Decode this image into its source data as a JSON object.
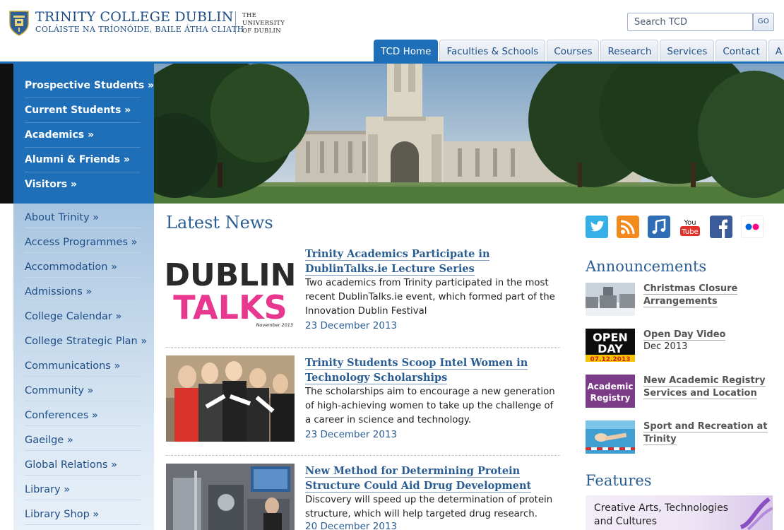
{
  "header": {
    "title": "TRINITY COLLEGE DUBLIN",
    "subtitle": "COLÁISTE NA TRÍONÓIDE, BAILE ÁTHA CLIATH",
    "university": [
      "THE",
      "UNIVERSITY",
      "OF DUBLIN"
    ],
    "logo_icon": "crest-icon",
    "search_placeholder": "Search TCD",
    "search_button": "GO"
  },
  "nav": {
    "tabs": [
      "TCD Home",
      "Faculties & Schools",
      "Courses",
      "Research",
      "Services",
      "Contact",
      "A – Z"
    ],
    "active": "TCD Home",
    "accent": "#1f6fb8"
  },
  "audience_menu": [
    "Prospective Students »",
    "Current Students »",
    "Academics »",
    "Alumni & Friends »",
    "Visitors »"
  ],
  "side_menu": [
    "About Trinity »",
    "Access Programmes »",
    "Accommodation »",
    "Admissions »",
    "College Calendar »",
    "College Strategic Plan »",
    "Communications »",
    "Community »",
    "Conferences »",
    "Gaeilge »",
    "Global Relations »",
    "Library »",
    "Library Shop »"
  ],
  "news": {
    "heading": "Latest News",
    "items": [
      {
        "title": "Trinity Academics Participate in DublinTalks.ie Lecture Series",
        "desc": "Two academics from Trinity participated in the most recent DublinTalks.ie event, which formed part of the Innovation Dublin Festival",
        "date": "23 December 2013",
        "thumb_text": [
          "DUBLIN",
          "TALKS",
          "November 2013"
        ]
      },
      {
        "title": "Trinity Students Scoop Intel Women in Technology Scholarships",
        "desc": "The scholarships aim to encourage a new generation of high-achieving women to take up the challenge of a career in science and technology.",
        "date": "23 December 2013"
      },
      {
        "title": "New Method for Determining Protein Structure Could Aid Drug Development",
        "desc": "Discovery will speed up the determination of protein structure, which will help targeted drug research.",
        "date": "20 December 2013"
      }
    ]
  },
  "social": [
    "twitter-icon",
    "rss-icon",
    "itunes-icon",
    "youtube-icon",
    "facebook-icon",
    "flickr-icon"
  ],
  "social_labels": {
    "youtube": [
      "You",
      "Tube"
    ]
  },
  "announcements": {
    "heading": "Announcements",
    "items": [
      {
        "title": "Christmas Closure Arrangements",
        "sub": ""
      },
      {
        "title": "Open Day Video",
        "sub": "Dec 2013",
        "thumb_text": [
          "OPEN",
          "DAY",
          "07.12.2013"
        ]
      },
      {
        "title": "New Academic Registry Services and Location",
        "sub": "",
        "thumb_text": [
          "Academic",
          "Registry"
        ]
      },
      {
        "title": "Sport and Recreation at Trinity",
        "sub": ""
      }
    ]
  },
  "features": {
    "heading": "Features",
    "item": "Creative Arts, Technologies and Cultures"
  }
}
